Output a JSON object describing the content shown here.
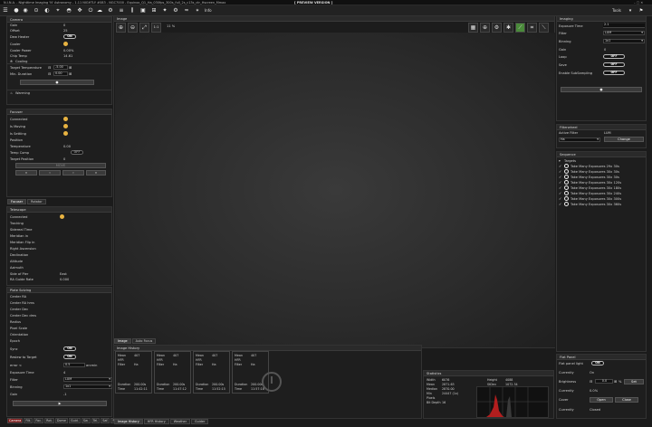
{
  "titlebar": {
    "title": "N.I.N.A. - Nighttime Imaging 'N' Astronomy - 1.11 NIGHTLY #083 - NGC7000 - Equinox_Q1_Ha_030fps_300s_full_2s_c13s_ctr_Hscreen_Mmax",
    "preview": "[ PREVIEW VERSION ]"
  },
  "toolbar": {
    "info_label": "Info",
    "tools_label": "Tools"
  },
  "camera": {
    "header": "Camera",
    "rows": [
      {
        "label": "Gain",
        "value": "0"
      },
      {
        "label": "Offset",
        "value": "25"
      },
      {
        "label": "Dew Heater",
        "value": "ON"
      },
      {
        "label": "Cooler",
        "value": ""
      },
      {
        "label": "Cooler Power",
        "value": "0.00%"
      },
      {
        "label": "Chip Temp",
        "value": "14.61"
      }
    ],
    "cooling_label": "Cooling",
    "target_temp_label": "Target Temperature",
    "target_temp": "-5.00",
    "min_duration_label": "Min. Duration",
    "min_duration": "0.00",
    "warming_label": "Warming"
  },
  "focuser": {
    "header": "Focuser",
    "rows": [
      "Connected",
      "Is Moving",
      "Is Settling",
      "Position",
      "Temperature",
      "Temp Comp",
      "Target Position"
    ],
    "temp_value": "0.00",
    "temp_comp": "OFF",
    "target_value": "0",
    "move_label": "MOVE"
  },
  "left_tabs": [
    "Focuser",
    "Rotator"
  ],
  "telescope": {
    "header": "Telescope",
    "rows": [
      {
        "label": "Connected",
        "value": ""
      },
      {
        "label": "Tracking",
        "value": ""
      },
      {
        "label": "Sidereal Time",
        "value": ""
      },
      {
        "label": "Meridian in",
        "value": ""
      },
      {
        "label": "Meridian Flip in",
        "value": ""
      },
      {
        "label": "Right Ascension",
        "value": ""
      },
      {
        "label": "Declination",
        "value": ""
      },
      {
        "label": "Altitude",
        "value": ""
      },
      {
        "label": "Azimuth",
        "value": ""
      },
      {
        "label": "Side of Pier",
        "value": "East"
      },
      {
        "label": "RA Guide Rate",
        "value": "0.000"
      },
      {
        "label": "Dec Guide Rate",
        "value": "0.000"
      }
    ]
  },
  "plate": {
    "header": "Plate Solving",
    "rows": [
      "Center RA",
      "Center RA hms",
      "Center Dec",
      "Center Dec dms",
      "Radius",
      "Pixel Scale",
      "Orientation",
      "Epoch"
    ],
    "sync_label": "Sync",
    "sync_value": "ON",
    "reslew_label": "Reslew to Target",
    "reslew_value": "ON",
    "error_label": "error <",
    "error_value": "0.5",
    "error_unit": "arcmin",
    "exp_label": "Exposure Time",
    "exp_value": "4",
    "filter_label": "Filter",
    "filter_value": "LUM",
    "binning_label": "Binning",
    "binning_value": "1x1",
    "gain_label": "Gain",
    "gain_value": "-1"
  },
  "bottom_tabs": [
    "Camera",
    "Filt.",
    "Foc.",
    "Rot.",
    "Dome",
    "Guid.",
    "Sw.",
    "Tel.",
    "Saf.",
    "FW"
  ],
  "image": {
    "header": "Image",
    "zoom": "11 %",
    "fit_label": "1:1",
    "tabs": [
      "Image",
      "Auto Focus"
    ]
  },
  "history": {
    "header": "Image History",
    "cards": [
      {
        "mean": "407",
        "hfr": "",
        "filter": "Ha",
        "duration": "200.00s",
        "time": "11:42:11"
      },
      {
        "mean": "407",
        "hfr": "",
        "filter": "Ha",
        "duration": "200.00s",
        "time": "11:47:12"
      },
      {
        "mean": "407",
        "hfr": "",
        "filter": "Ha",
        "duration": "200.00s",
        "time": "11:52:15"
      },
      {
        "mean": "407",
        "hfr": "",
        "filter": "Ha",
        "duration": "200.00s",
        "time": "11:57:18"
      }
    ],
    "labels": {
      "mean": "Mean",
      "hfr": "HFR",
      "filter": "Filter",
      "duration": "Duration",
      "time": "Time"
    },
    "tabs": [
      "Image History",
      "HFR History",
      "Weather",
      "Guider"
    ]
  },
  "stats": {
    "header": "Statistics",
    "left": [
      {
        "label": "Width",
        "value": "6076"
      },
      {
        "label": "Mean",
        "value": "2871.63"
      },
      {
        "label": "Median",
        "value": "2870.00"
      },
      {
        "label": "Min",
        "value": "24447 (1x)"
      },
      {
        "label": "Pixels",
        "value": ""
      },
      {
        "label": "Bit Depth",
        "value": "16"
      }
    ],
    "right": [
      {
        "label": "Height",
        "value": "4088"
      },
      {
        "label": "StDev",
        "value": "1072.34"
      },
      {
        "label": "MAD",
        "value": "406.00"
      },
      {
        "label": "Max",
        "value": "65535 (1x)"
      },
      {
        "label": "HFR",
        "value": ""
      },
      {
        "label": "Stars",
        "value": ""
      }
    ]
  },
  "imaging": {
    "header": "Imaging",
    "rows": [
      {
        "label": "Exposure Time",
        "value": "2.1"
      },
      {
        "label": "Filter",
        "value": "LUM"
      },
      {
        "label": "Binning",
        "value": "1x1"
      },
      {
        "label": "Gain",
        "value": "0"
      },
      {
        "label": "Loop",
        "value": "OFF"
      },
      {
        "label": "Save",
        "value": "OFF"
      },
      {
        "label": "Enable SubSampling",
        "value": "OFF"
      }
    ]
  },
  "filterwheel": {
    "header": "Filterwheel",
    "active_label": "Active Filter",
    "active_value": "LUM",
    "select_value": "Ha",
    "change_label": "Change"
  },
  "sequence": {
    "header": "Sequence",
    "targets_label": "Targets",
    "items": [
      "Take Many Exposures 29x 30s",
      "Take Many Exposures 30x 30s",
      "Take Many Exposures 30x 30s",
      "Take Many Exposures 30x 120s",
      "Take Many Exposures 30x 180s",
      "Take Many Exposures 30x 240s",
      "Take Many Exposures 30x 300s",
      "Take Many Exposures 30x 360s"
    ]
  },
  "flatpanel": {
    "header": "Flat Panel",
    "light_label": "Flat panel light",
    "light_value": "ON",
    "currently1_label": "Currently",
    "currently1_value": "On",
    "brightness_label": "Brightness",
    "brightness_value": "0.0",
    "brightness_unit": "%",
    "set_label": "Set",
    "currently2_label": "Currently",
    "currently2_value": "0.0%",
    "cover_label": "Cover",
    "open_label": "Open",
    "close_label": "Close",
    "currently3_label": "Currently",
    "currently3_value": "Closed"
  }
}
